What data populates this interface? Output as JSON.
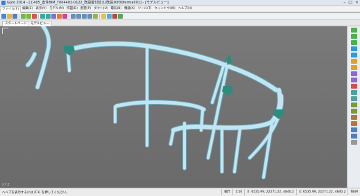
{
  "window": {
    "title": "Gpro 2014 - [エ405_案件BIM_T004402-0122_既設盤付替え(既設)KY00ferma001] - [モデルビュー]",
    "controls": [
      "–",
      "□",
      "×"
    ]
  },
  "menu": {
    "items": [
      "ファイル(F)",
      "編集(E)",
      "表示(V)",
      "モデル(M)",
      "作図(D)",
      "配管(P)",
      "ダクト(U)",
      "電気(B)",
      "機器(K)",
      "ツール(T)",
      "ウィンドウ(W)",
      "ヘルプ(H)"
    ],
    "active_index": 0
  },
  "tabs": {
    "start": "スタートページ",
    "model": "モデルビュー"
  },
  "viewport": {
    "pipe_color": "#bfe6f2",
    "pipe_edge": "#6aa9bd",
    "bracket_color": "#2f8b7e",
    "axis_caption": "X Y Z"
  },
  "status": {
    "message": "ヘルプを表示するには [F1] を押してください。",
    "zoom_label": "縮尺",
    "zoom_value": "1:50",
    "coord_a": "X: 6535.99, 22271.22, 4840.2",
    "coord_b": "X: 6535.99, 22271.22, 4840.2",
    "mode": "NUM"
  }
}
